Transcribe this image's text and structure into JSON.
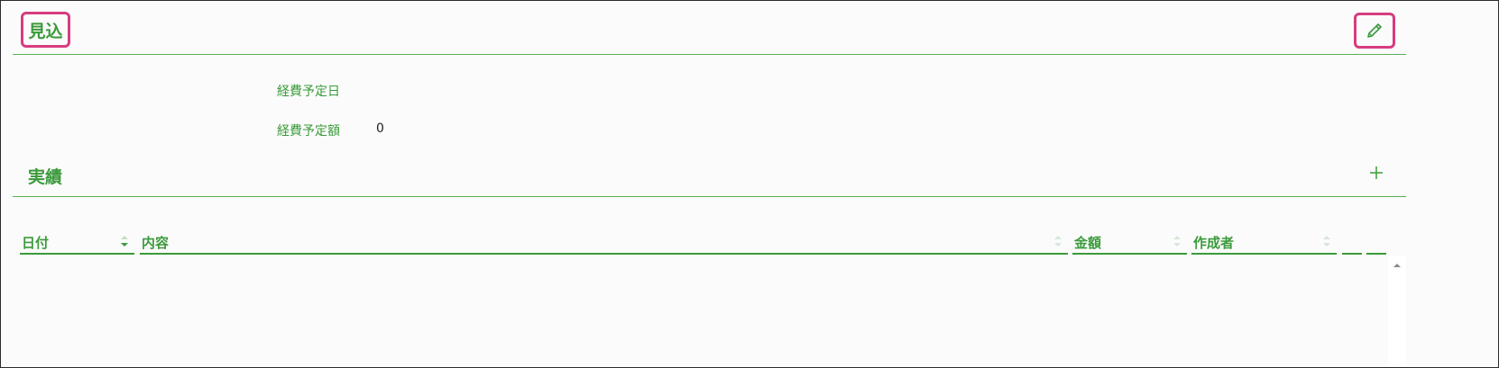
{
  "forecast": {
    "title": "見込",
    "edit_icon": "pencil-icon",
    "fields": [
      {
        "label": "経費予定日",
        "value": ""
      },
      {
        "label": "経費予定額",
        "value": "0"
      }
    ]
  },
  "actuals": {
    "title": "実績",
    "add_icon": "plus-icon",
    "columns": [
      {
        "label": "日付",
        "sort": "desc"
      },
      {
        "label": "内容",
        "sort": "none"
      },
      {
        "label": "金額",
        "sort": "none"
      },
      {
        "label": "作成者",
        "sort": "none"
      },
      {
        "label": "",
        "sort": "none"
      },
      {
        "label": "",
        "sort": "none"
      }
    ]
  },
  "colors": {
    "accent": "#3b9a3b",
    "highlight": "#d63d7f"
  }
}
